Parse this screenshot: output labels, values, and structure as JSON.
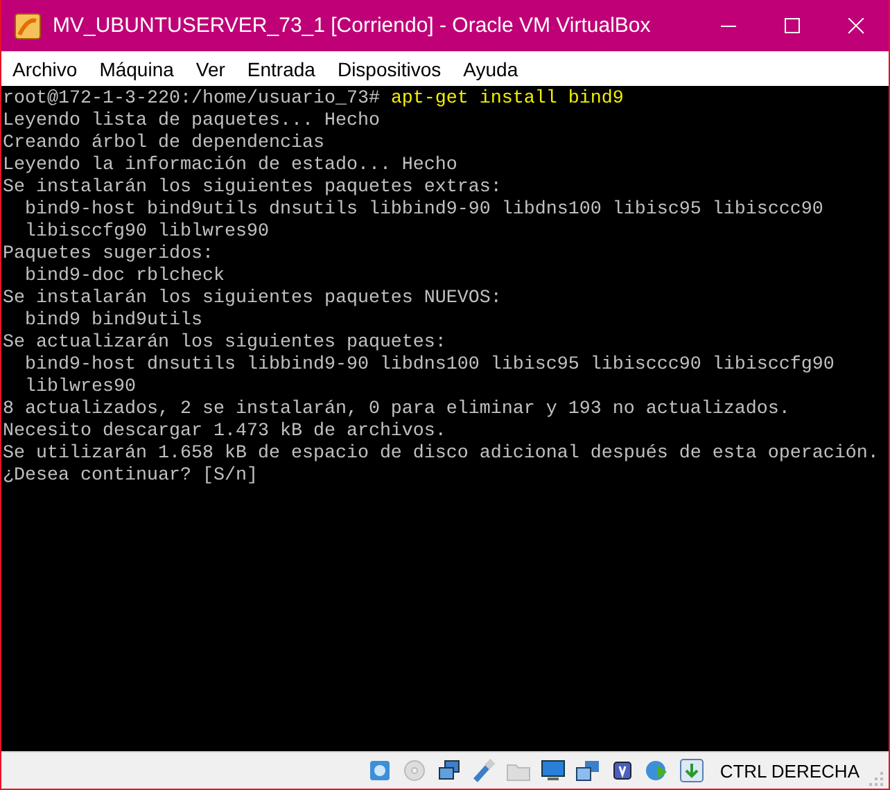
{
  "window": {
    "title": "MV_UBUNTUSERVER_73_1 [Corriendo] - Oracle VM VirtualBox"
  },
  "menu": [
    "Archivo",
    "Máquina",
    "Ver",
    "Entrada",
    "Dispositivos",
    "Ayuda"
  ],
  "terminal": {
    "lines": [
      {
        "kind": "prompt",
        "prompt": "root@172-1-3-220:/home/usuario_73#",
        "command": "apt-get install bind9"
      },
      {
        "kind": "output",
        "text": "Leyendo lista de paquetes... Hecho"
      },
      {
        "kind": "output",
        "text": "Creando árbol de dependencias"
      },
      {
        "kind": "output",
        "text": "Leyendo la información de estado... Hecho"
      },
      {
        "kind": "output",
        "text": "Se instalarán los siguientes paquetes extras:"
      },
      {
        "kind": "output",
        "text": "  bind9-host bind9utils dnsutils libbind9-90 libdns100 libisc95 libisccc90"
      },
      {
        "kind": "output",
        "text": "  libisccfg90 liblwres90"
      },
      {
        "kind": "output",
        "text": "Paquetes sugeridos:"
      },
      {
        "kind": "output",
        "text": "  bind9-doc rblcheck"
      },
      {
        "kind": "output",
        "text": "Se instalarán los siguientes paquetes NUEVOS:"
      },
      {
        "kind": "output",
        "text": "  bind9 bind9utils"
      },
      {
        "kind": "output",
        "text": "Se actualizarán los siguientes paquetes:"
      },
      {
        "kind": "output",
        "text": "  bind9-host dnsutils libbind9-90 libdns100 libisc95 libisccc90 libisccfg90"
      },
      {
        "kind": "output",
        "text": "  liblwres90"
      },
      {
        "kind": "output",
        "text": "8 actualizados, 2 se instalarán, 0 para eliminar y 193 no actualizados."
      },
      {
        "kind": "output",
        "text": "Necesito descargar 1.473 kB de archivos."
      },
      {
        "kind": "output",
        "text": "Se utilizarán 1.658 kB de espacio de disco adicional después de esta operación."
      },
      {
        "kind": "output",
        "text": "¿Desea continuar? [S/n]"
      }
    ]
  },
  "status_bar": {
    "host_key": "CTRL DERECHA"
  }
}
